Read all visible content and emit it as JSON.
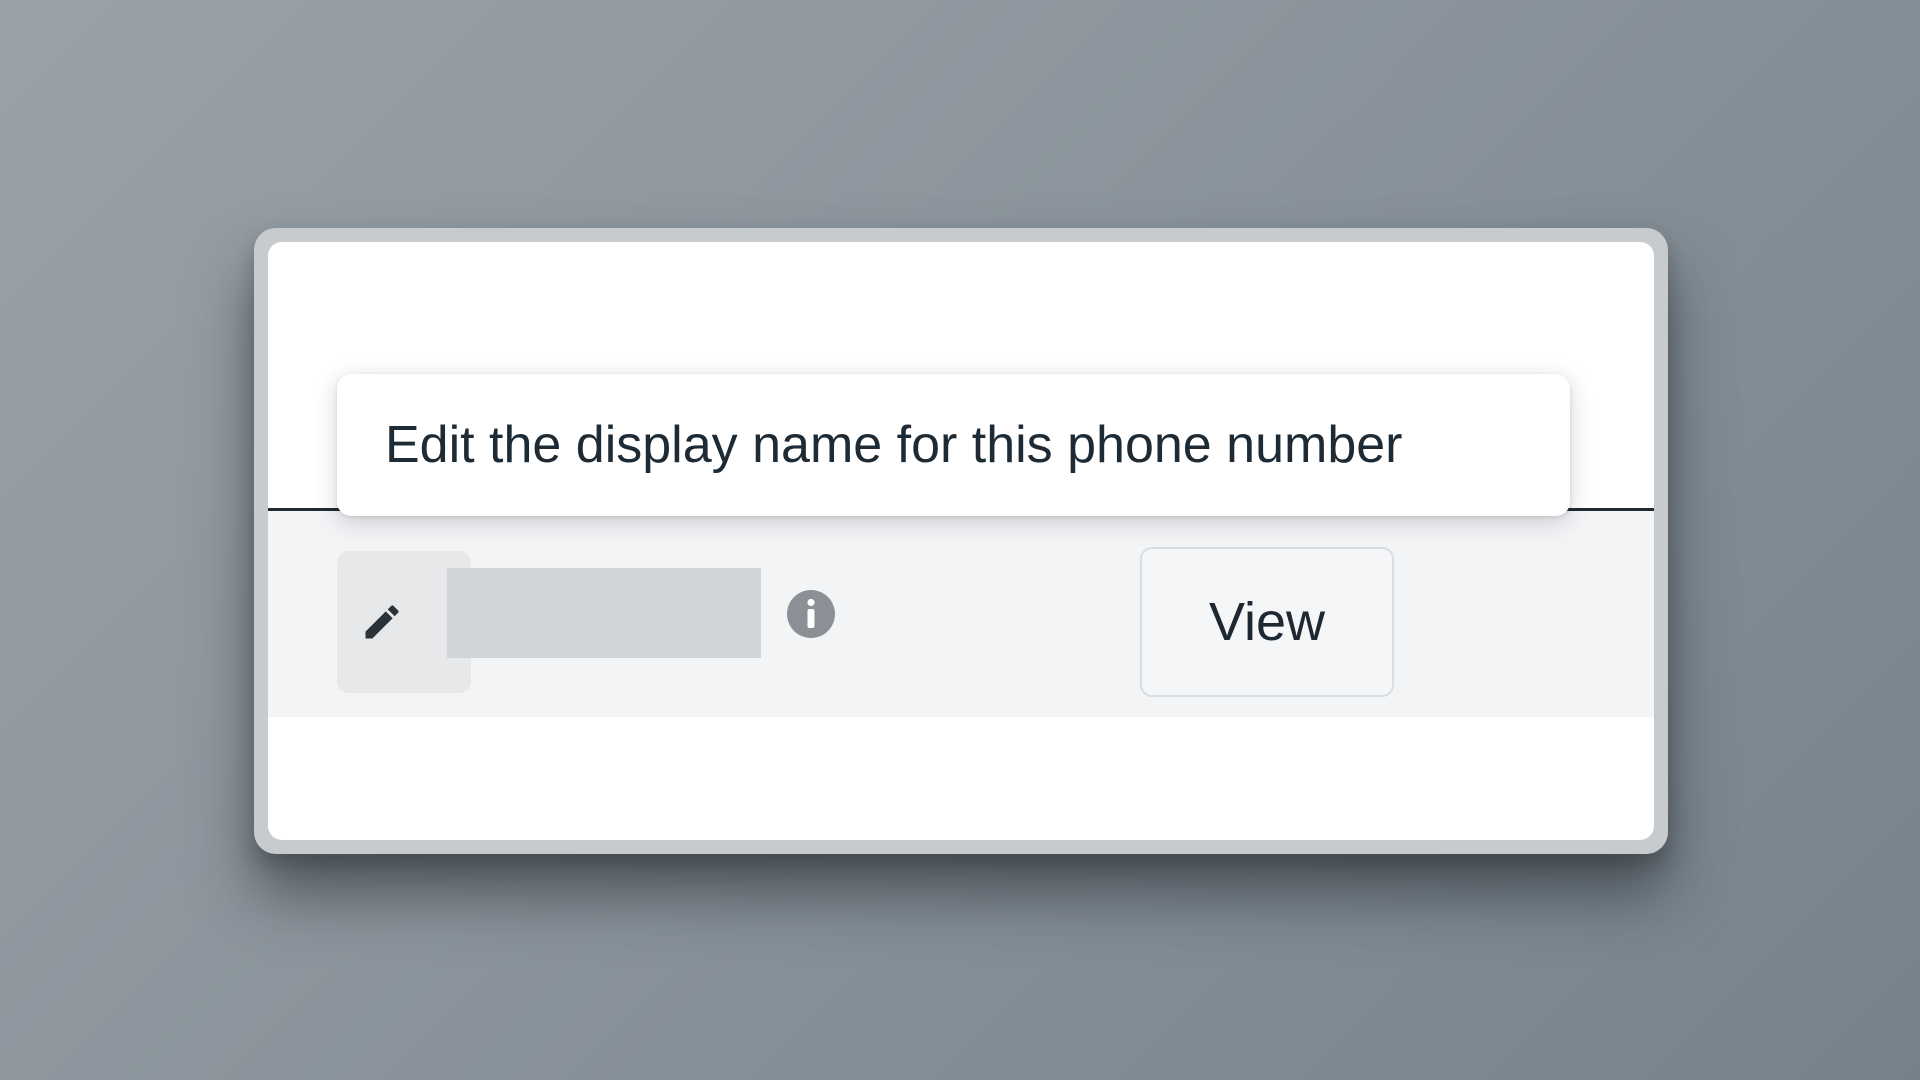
{
  "tooltip": {
    "text": "Edit the display name for this phone number"
  },
  "row": {
    "view_button_label": "View",
    "edit_icon": "pencil-icon",
    "info_icon": "info-icon"
  },
  "colors": {
    "divider": "#1f2a33",
    "row_background": "#f3f4f6",
    "text": "#1e2b35",
    "info_icon": "#8a9096"
  }
}
